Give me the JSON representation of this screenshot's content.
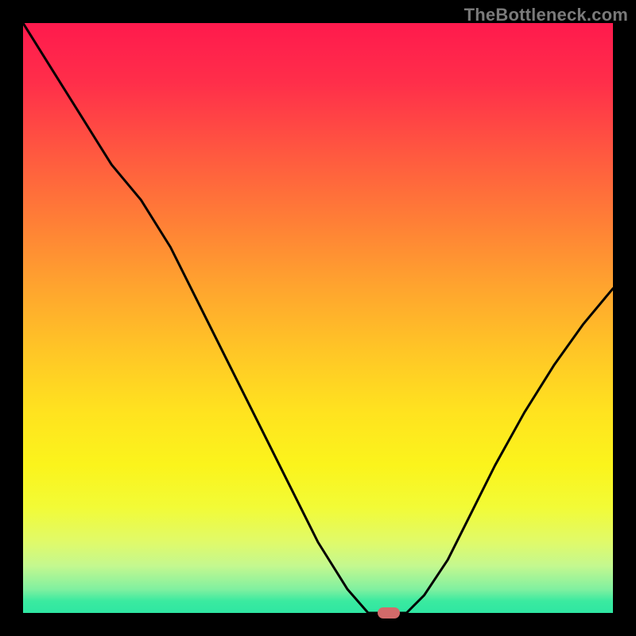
{
  "watermark": "TheBottleneck.com",
  "chart_data": {
    "type": "line",
    "title": "",
    "xlabel": "",
    "ylabel": "",
    "xlim": [
      0,
      1
    ],
    "ylim": [
      0,
      1
    ],
    "x": [
      0.0,
      0.05,
      0.1,
      0.15,
      0.2,
      0.25,
      0.3,
      0.35,
      0.4,
      0.45,
      0.5,
      0.55,
      0.585,
      0.62,
      0.65,
      0.68,
      0.72,
      0.76,
      0.8,
      0.85,
      0.9,
      0.95,
      1.0
    ],
    "y": [
      1.0,
      0.92,
      0.84,
      0.76,
      0.7,
      0.62,
      0.52,
      0.42,
      0.32,
      0.22,
      0.12,
      0.04,
      0.0,
      0.0,
      0.0,
      0.03,
      0.09,
      0.17,
      0.25,
      0.34,
      0.42,
      0.49,
      0.55
    ],
    "marker": {
      "x": 0.62,
      "y": 0.0
    },
    "background_gradient": {
      "top": "#ff1a4d",
      "mid": "#ffe31f",
      "bottom": "#2fe6a2"
    }
  }
}
